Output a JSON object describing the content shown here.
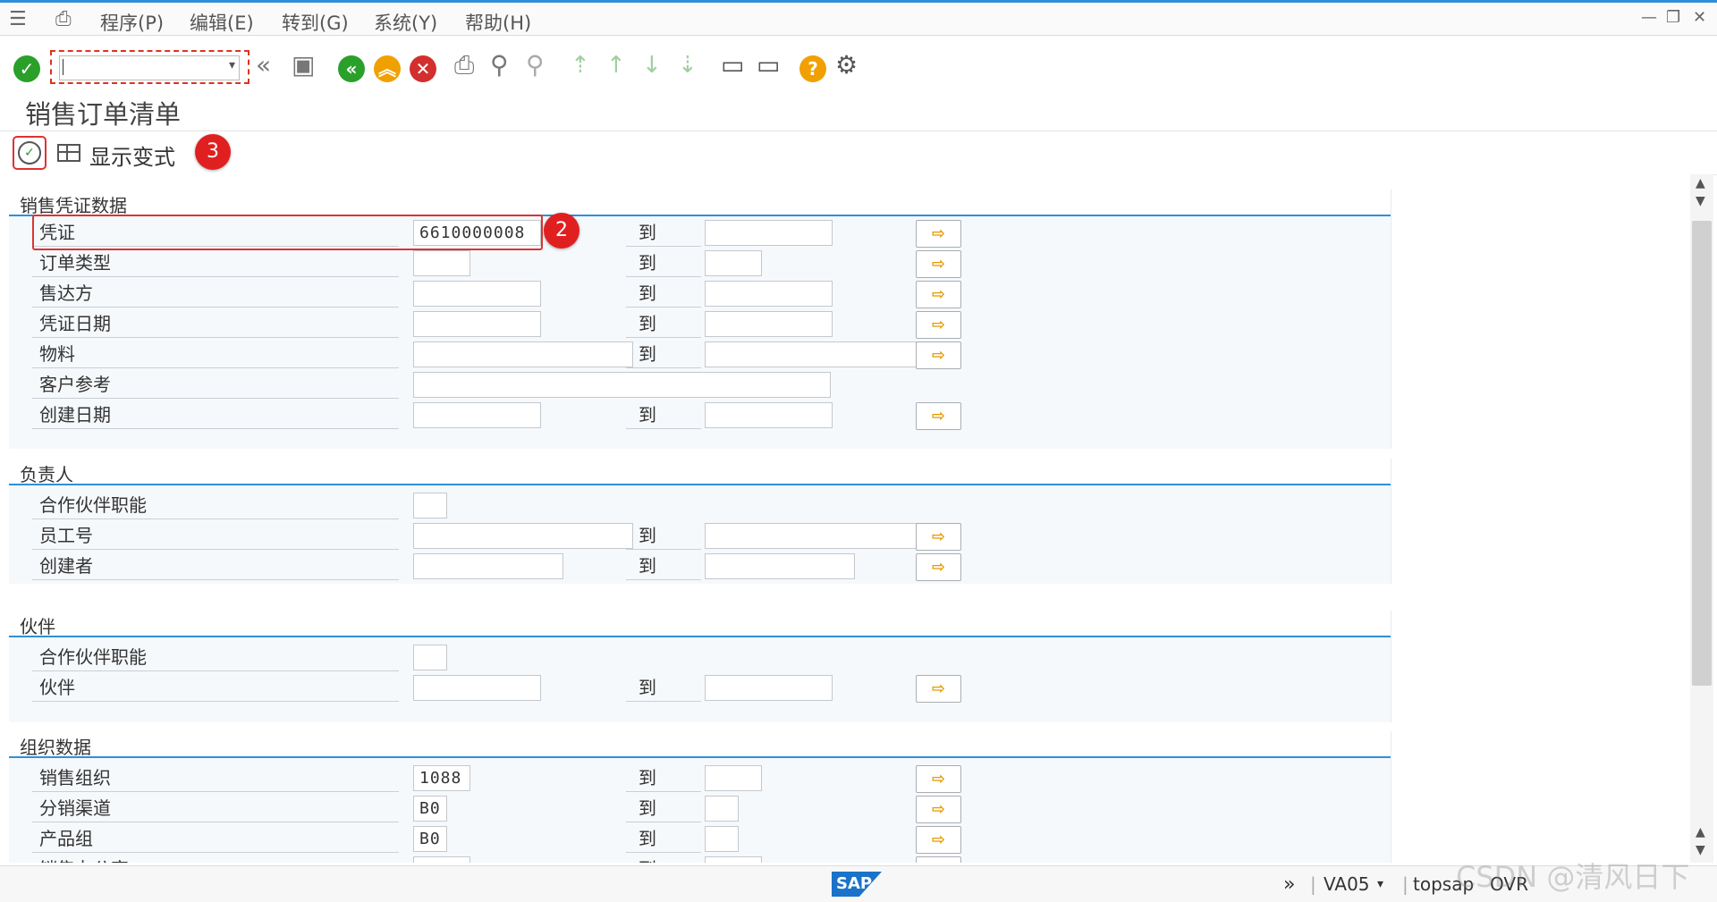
{
  "menubar": {
    "items": [
      "程序(P)",
      "编辑(E)",
      "转到(G)",
      "系统(Y)",
      "帮助(H)"
    ],
    "window_controls": [
      "—",
      "❐",
      "✕"
    ]
  },
  "toolbar": {
    "command_field": {
      "value": "",
      "placeholder": ""
    },
    "icons": [
      "enter-icon",
      "back-icon",
      "save-icon",
      "exit-icon",
      "up-icon",
      "cancel-icon",
      "print-icon",
      "find-icon",
      "find-next-icon",
      "first-page-icon",
      "prev-page-icon",
      "next-page-icon",
      "last-page-icon",
      "new-session-icon",
      "shortcut-icon",
      "help-icon",
      "settings-icon"
    ]
  },
  "page": {
    "title": "销售订单清单"
  },
  "app_toolbar": {
    "layout_label": "显示变式",
    "badge3": "3"
  },
  "badges": {
    "b2": "2"
  },
  "groups": [
    {
      "title": "销售凭证数据",
      "rows": [
        {
          "label": "凭证",
          "from": "6610000008",
          "to": "",
          "range": true
        },
        {
          "label": "订单类型",
          "from": "",
          "to": "",
          "range": true
        },
        {
          "label": "售达方",
          "from": "",
          "to": "",
          "range": true
        },
        {
          "label": "凭证日期",
          "from": "",
          "to": "",
          "range": true
        },
        {
          "label": "物料",
          "from": "",
          "to": "",
          "range": true
        },
        {
          "label": "客户参考",
          "from": "",
          "to": "",
          "range": false
        },
        {
          "label": "创建日期",
          "from": "",
          "to": "",
          "range": true
        }
      ]
    },
    {
      "title": "负责人",
      "rows": [
        {
          "label": "合作伙伴职能",
          "from": "",
          "to": "",
          "range": false
        },
        {
          "label": "员工号",
          "from": "",
          "to": "",
          "range": true
        },
        {
          "label": "创建者",
          "from": "",
          "to": "",
          "range": true
        }
      ]
    },
    {
      "title": "伙伴",
      "rows": [
        {
          "label": "合作伙伴职能",
          "from": "",
          "to": "",
          "range": false
        },
        {
          "label": "伙伴",
          "from": "",
          "to": "",
          "range": true
        }
      ]
    },
    {
      "title": "组织数据",
      "rows": [
        {
          "label": "销售组织",
          "from": "1088",
          "to": "",
          "range": true
        },
        {
          "label": "分销渠道",
          "from": "B0",
          "to": "",
          "range": true
        },
        {
          "label": "产品组",
          "from": "B0",
          "to": "",
          "range": true
        },
        {
          "label": "销售办公室",
          "from": "",
          "to": "",
          "range": true
        }
      ]
    }
  ],
  "to_label": "到",
  "statusbar": {
    "transaction": "VA05",
    "system": "topsap",
    "mode": "OVR",
    "sap_logo": "SAP"
  },
  "watermark": "CSDN @清风日下"
}
